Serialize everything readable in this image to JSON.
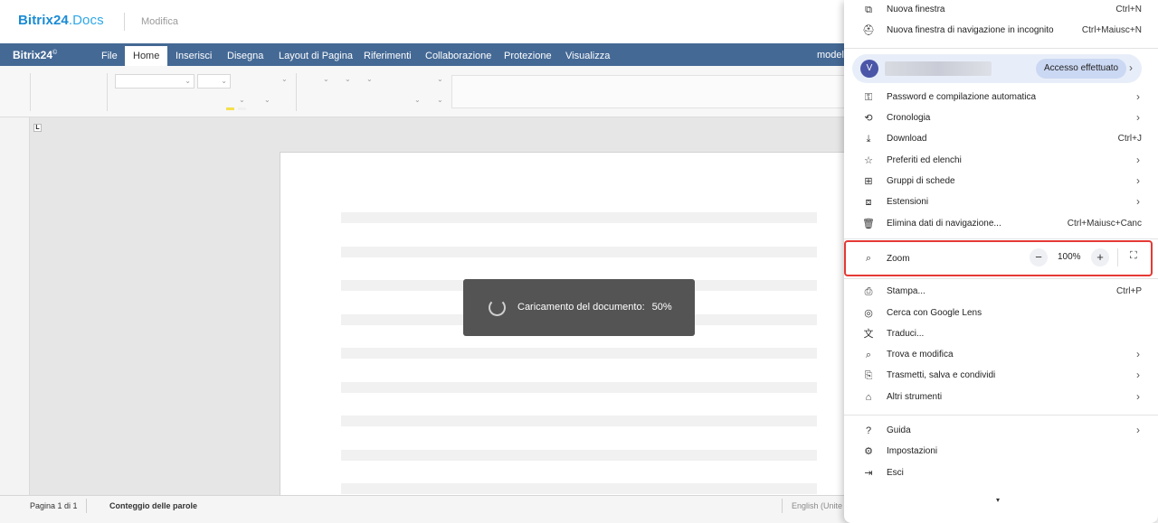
{
  "app": {
    "logo_main": "Bitrix24",
    "logo_suffix": ".Docs",
    "mode": "Modifica",
    "menu_logo": "Bitrix24",
    "menu_logo_mark": "©"
  },
  "menu_tabs": [
    {
      "label": "File"
    },
    {
      "label": "Home",
      "active": true
    },
    {
      "label": "Inserisci"
    },
    {
      "label": "Disegna"
    },
    {
      "label": "Layout di Pagina"
    },
    {
      "label": "Riferimenti"
    },
    {
      "label": "Collaborazione"
    },
    {
      "label": "Protezione"
    },
    {
      "label": "Visualizza"
    }
  ],
  "menu_right": "modelli",
  "loading": {
    "text": "Caricamento del documento:",
    "percent": "50%"
  },
  "status": {
    "page": "Pagina 1 di 1",
    "words": "Conteggio delle parole",
    "language": "English (Unite"
  },
  "browser_menu": {
    "items_top": [
      {
        "icon": "new-window-icon",
        "label": "Nuova finestra",
        "shortcut": "Ctrl+N"
      },
      {
        "icon": "incognito-icon",
        "label": "Nuova finestra di navigazione in incognito",
        "shortcut": "Ctrl+Maiusc+N"
      }
    ],
    "profile": {
      "initial": "V",
      "status": "Accesso effettuato"
    },
    "items_mid": [
      {
        "icon": "key-icon",
        "label": "Password e compilazione automatica",
        "shortcut": "",
        "arrow": true
      },
      {
        "icon": "history-icon",
        "label": "Cronologia",
        "shortcut": "",
        "arrow": true
      },
      {
        "icon": "download-icon",
        "label": "Download",
        "shortcut": "Ctrl+J",
        "arrow": false
      },
      {
        "icon": "star-icon",
        "label": "Preferiti ed elenchi",
        "shortcut": "",
        "arrow": true
      },
      {
        "icon": "tab-groups-icon",
        "label": "Gruppi di schede",
        "shortcut": "",
        "arrow": true
      },
      {
        "icon": "extensions-icon",
        "label": "Estensioni",
        "shortcut": "",
        "arrow": true
      },
      {
        "icon": "trash-icon",
        "label": "Elimina dati di navigazione...",
        "shortcut": "Ctrl+Maiusc+Canc",
        "arrow": false
      }
    ],
    "zoom": {
      "label": "Zoom",
      "value": "100%",
      "minus": "−",
      "plus": "+",
      "fullscreen": "⛶"
    },
    "items_lower": [
      {
        "icon": "print-icon",
        "label": "Stampa...",
        "shortcut": "Ctrl+P",
        "arrow": false
      },
      {
        "icon": "google-lens-icon",
        "label": "Cerca con Google Lens",
        "shortcut": "",
        "arrow": false
      },
      {
        "icon": "translate-icon",
        "label": "Traduci...",
        "shortcut": "",
        "arrow": false
      },
      {
        "icon": "find-icon",
        "label": "Trova e modifica",
        "shortcut": "",
        "arrow": true
      },
      {
        "icon": "cast-icon",
        "label": "Trasmetti, salva e condividi",
        "shortcut": "",
        "arrow": true
      },
      {
        "icon": "toolbox-icon",
        "label": "Altri strumenti",
        "shortcut": "",
        "arrow": true
      }
    ],
    "items_bottom": [
      {
        "icon": "help-icon",
        "label": "Guida",
        "shortcut": "",
        "arrow": true
      },
      {
        "icon": "settings-icon",
        "label": "Impostazioni",
        "shortcut": "",
        "arrow": false
      },
      {
        "icon": "exit-icon",
        "label": "Esci",
        "shortcut": "",
        "arrow": false
      }
    ],
    "more_indicator": "▾"
  }
}
